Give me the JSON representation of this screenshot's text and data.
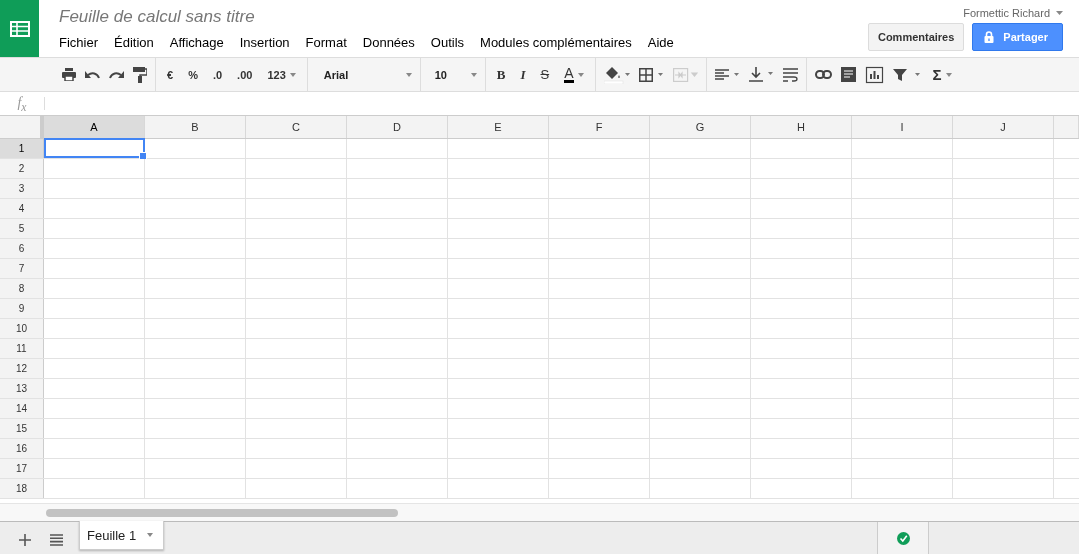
{
  "document": {
    "title": "Feuille de calcul sans titre"
  },
  "menu": [
    "Fichier",
    "Édition",
    "Affichage",
    "Insertion",
    "Format",
    "Données",
    "Outils",
    "Modules complémentaires",
    "Aide"
  ],
  "account": {
    "name": "Formettic Richard"
  },
  "buttons": {
    "comments": "Commentaires",
    "share": "Partager"
  },
  "toolbar": {
    "number_formats": [
      "€",
      "%",
      ".0",
      ".00"
    ],
    "more_formats": "123",
    "font": "Arial",
    "font_size": "10",
    "text_styles": [
      "B",
      "I",
      "S"
    ],
    "text_color": "A",
    "merge_cells": {
      "disabled": true
    },
    "functions": "Σ"
  },
  "formula_bar": {
    "label": "f$_{x}$"
  },
  "grid": {
    "columns": [
      {
        "label": "A",
        "selected": true
      },
      {
        "label": "B",
        "selected": false
      },
      {
        "label": "C",
        "selected": false
      },
      {
        "label": "D",
        "selected": false
      },
      {
        "label": "E",
        "selected": false
      },
      {
        "label": "F",
        "selected": false
      },
      {
        "label": "G",
        "selected": false
      },
      {
        "label": "H",
        "selected": false
      },
      {
        "label": "I",
        "selected": false
      },
      {
        "label": "J",
        "selected": false
      }
    ],
    "rows": [
      {
        "label": "1",
        "selected": true
      },
      {
        "label": "2",
        "selected": false
      },
      {
        "label": "3",
        "selected": false
      },
      {
        "label": "4",
        "selected": false
      },
      {
        "label": "5",
        "selected": false
      },
      {
        "label": "6",
        "selected": false
      },
      {
        "label": "7",
        "selected": false
      },
      {
        "label": "8",
        "selected": false
      },
      {
        "label": "9",
        "selected": false
      },
      {
        "label": "10",
        "selected": false
      },
      {
        "label": "11",
        "selected": false
      },
      {
        "label": "12",
        "selected": false
      },
      {
        "label": "13",
        "selected": false
      },
      {
        "label": "14",
        "selected": false
      },
      {
        "label": "15",
        "selected": false
      },
      {
        "label": "16",
        "selected": false
      },
      {
        "label": "17",
        "selected": false
      },
      {
        "label": "18",
        "selected": false
      }
    ]
  },
  "sheets": [
    {
      "label": "Feuille 1",
      "selected": true
    }
  ],
  "save_status": {
    "saved": true
  }
}
